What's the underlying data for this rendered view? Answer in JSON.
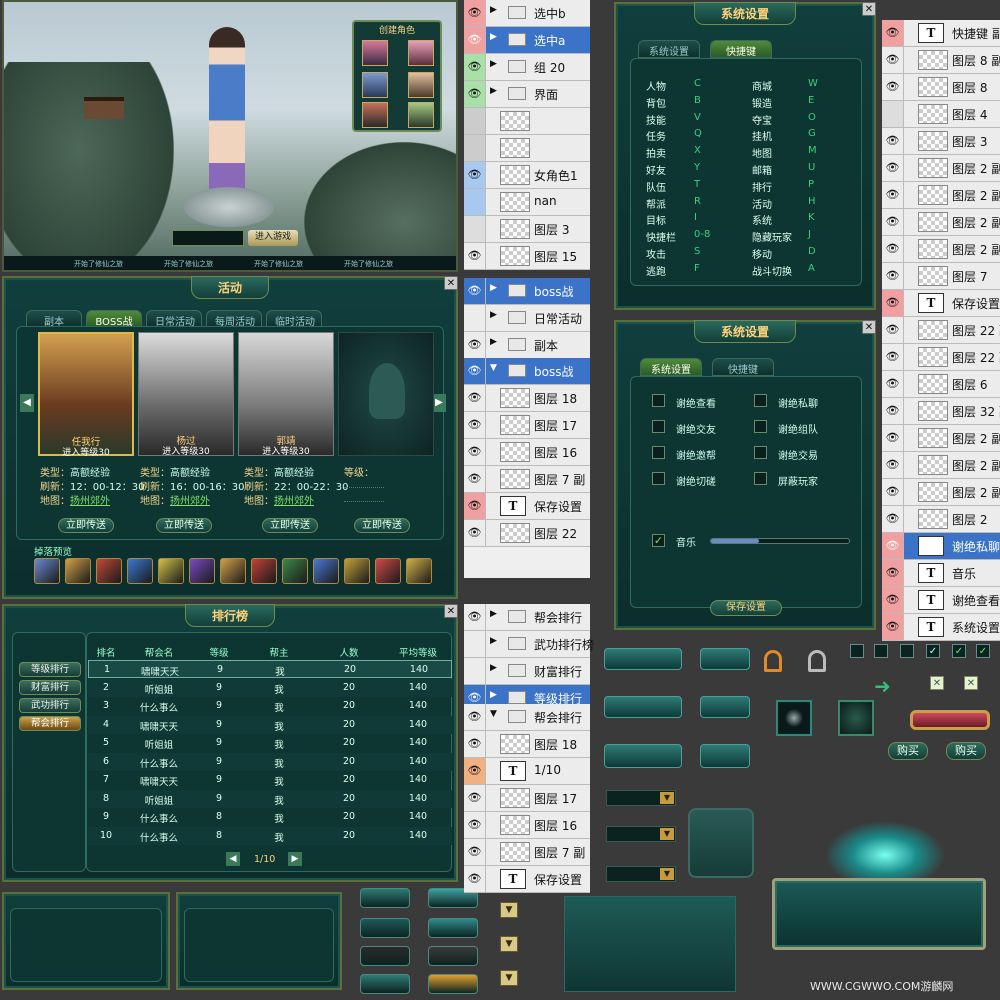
{
  "create_char": {
    "title": "创建角色",
    "enter_button": "进入游戏",
    "footer_texts": [
      "开始了修仙之旅",
      "开始了修仙之旅",
      "开始了修仙之旅",
      "开始了修仙之旅"
    ]
  },
  "activity": {
    "title": "活动",
    "tabs": [
      "副本",
      "BOSS战",
      "日常活动",
      "每周活动",
      "临时活动"
    ],
    "cards": [
      {
        "name": "任我行",
        "level": "进入等级30",
        "type_label": "类型：",
        "type": "高额经验",
        "refresh_label": "刷新：",
        "refresh": "12：00-12：30",
        "map_label": "地图：",
        "map": "扬州郊外",
        "button": "立即传送"
      },
      {
        "name": "杨过",
        "level": "进入等级30",
        "type_label": "类型：",
        "type": "高额经验",
        "refresh_label": "刷新：",
        "refresh": "16：00-16：30",
        "map_label": "地图：",
        "map": "扬州郊外",
        "button": "立即传送"
      },
      {
        "name": "郭靖",
        "level": "进入等级30",
        "type_label": "类型：",
        "type": "高额经验",
        "refresh_label": "刷新：",
        "refresh": "22：00-22：30",
        "map_label": "地图：",
        "map": "扬州郊外",
        "button": "立即传送"
      },
      {
        "name": "",
        "level": "",
        "type_label": "等级：",
        "type": "",
        "refresh_label": "",
        "refresh": "",
        "map_label": "",
        "map": "",
        "button": "立即传送"
      }
    ],
    "drops_label": "掉落预览"
  },
  "ranking": {
    "title": "排行榜",
    "side_buttons": [
      "等级排行",
      "财富排行",
      "武功排行",
      "帮会排行"
    ],
    "headers": [
      "排名",
      "帮会名",
      "等级",
      "帮主",
      "人数",
      "平均等级"
    ],
    "rows": [
      [
        "1",
        "啸啸天天",
        "9",
        "我",
        "20",
        "140"
      ],
      [
        "2",
        "听姐姐",
        "9",
        "我",
        "20",
        "140"
      ],
      [
        "3",
        "什么事么",
        "9",
        "我",
        "20",
        "140"
      ],
      [
        "4",
        "啸啸天天",
        "9",
        "我",
        "20",
        "140"
      ],
      [
        "5",
        "听姐姐",
        "9",
        "我",
        "20",
        "140"
      ],
      [
        "6",
        "什么事么",
        "9",
        "我",
        "20",
        "140"
      ],
      [
        "7",
        "啸啸天天",
        "9",
        "我",
        "20",
        "140"
      ],
      [
        "8",
        "听姐姐",
        "9",
        "我",
        "20",
        "140"
      ],
      [
        "9",
        "什么事么",
        "8",
        "我",
        "20",
        "140"
      ],
      [
        "10",
        "什么事么",
        "8",
        "我",
        "20",
        "140"
      ]
    ],
    "page": "1/10"
  },
  "settings1": {
    "title": "系统设置",
    "tabs": [
      "系统设置",
      "快捷键"
    ],
    "left_keys": [
      [
        "人物",
        "C"
      ],
      [
        "背包",
        "B"
      ],
      [
        "技能",
        "V"
      ],
      [
        "任务",
        "Q"
      ],
      [
        "拍卖",
        "X"
      ],
      [
        "好友",
        "Y"
      ],
      [
        "队伍",
        "T"
      ],
      [
        "帮派",
        "R"
      ],
      [
        "目标",
        "I"
      ],
      [
        "快捷栏",
        "0-8"
      ],
      [
        "攻击",
        "S"
      ],
      [
        "逃跑",
        "F"
      ]
    ],
    "right_keys": [
      [
        "商城",
        "W"
      ],
      [
        "锻造",
        "E"
      ],
      [
        "夺宝",
        "O"
      ],
      [
        "挂机",
        "G"
      ],
      [
        "地图",
        "M"
      ],
      [
        "邮箱",
        "U"
      ],
      [
        "排行",
        "P"
      ],
      [
        "活动",
        "H"
      ],
      [
        "系统",
        "K"
      ],
      [
        "隐藏玩家",
        "J"
      ],
      [
        "移动",
        "D"
      ],
      [
        "战斗切换",
        "A"
      ]
    ]
  },
  "settings2": {
    "title": "系统设置",
    "tabs": [
      "系统设置",
      "快捷键"
    ],
    "left_options": [
      "谢绝查看",
      "谢绝交友",
      "谢绝邀帮",
      "谢绝切磋"
    ],
    "right_options": [
      "谢绝私聊",
      "谢绝组队",
      "谢绝交易",
      "屏蔽玩家"
    ],
    "music_label": "音乐",
    "music_level": 0.35,
    "save_button": "保存设置"
  },
  "layers_a": [
    "选中b",
    "选中a",
    "组 20",
    "界面",
    "",
    "",
    "女角色1",
    "nan",
    "图层 3",
    "图层 15"
  ],
  "layers_b": [
    "boss战",
    "日常活动",
    "副本"
  ],
  "layers_c": [
    "boss战",
    "图层 18",
    "图层 17",
    "图层 16",
    "图层 7 副",
    "保存设置",
    "图层 22"
  ],
  "layers_d": [
    "帮会排行",
    "武功排行榜",
    "财富排行",
    "等级排行"
  ],
  "layers_e": [
    "帮会排行",
    "图层 18",
    "1/10",
    "图层 17",
    "图层 16",
    "图层 7 副",
    "保存设置"
  ],
  "layers_f": [
    "快捷键 副",
    "图层 8 副本",
    "图层 8",
    "图层 4",
    "图层 3",
    "图层 2 副本",
    "图层 2 副本",
    "图层 2 副本",
    "图层 2 副本",
    "图层 7",
    "保存设置",
    "图层 22 副",
    "图层 22 副",
    "图层 6",
    "图层 32 副",
    "图层 2 副本",
    "图层 2 副本",
    "图层 2 副本",
    "图层 2",
    "谢绝私聊",
    "音乐",
    "谢绝查看",
    "系统设置"
  ],
  "misc": {
    "buy_label": "购买",
    "watermark": "WWW.CGWWO.COM游麟网"
  },
  "colors": {
    "panel": "#0c2e2c",
    "gold": "#f2d58a",
    "accent_green": "#4f8a3a",
    "layer_select": "#3a73c8"
  }
}
